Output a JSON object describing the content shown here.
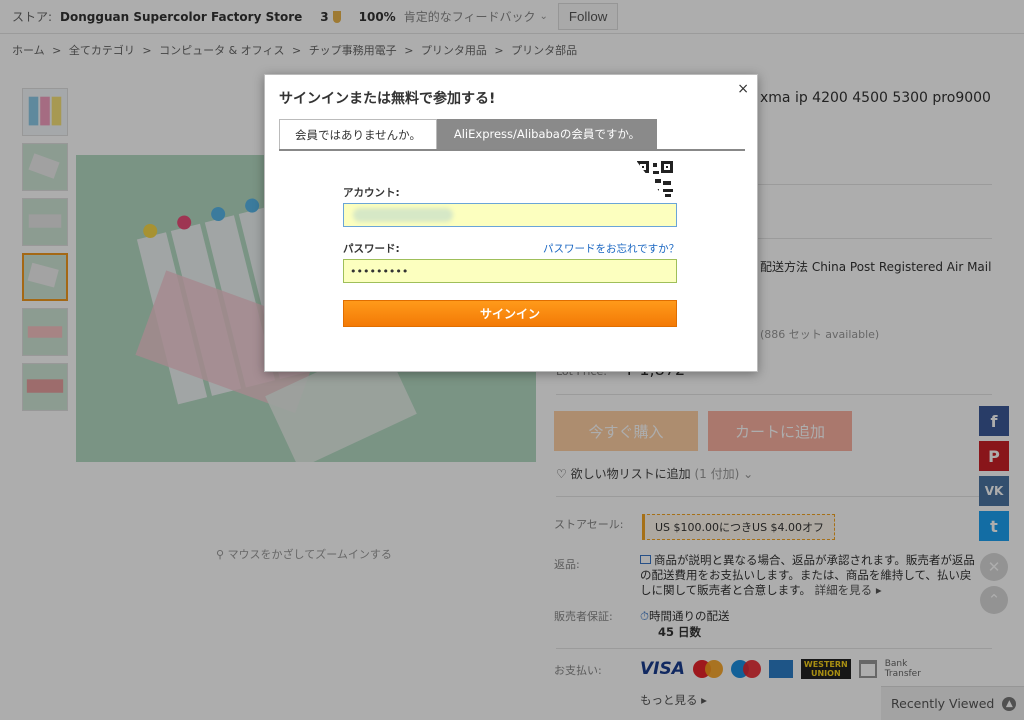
{
  "store_bar": {
    "label": "ストア:",
    "store_name": "Dongguan Supercolor Factory Store",
    "level": "3",
    "positive_pct": "100%",
    "feedback_label": "肯定的なフィードバック",
    "follow_label": "Follow"
  },
  "breadcrumb": [
    "ホーム",
    ">",
    "全てカテゴリ",
    ">",
    "コンピュータ & オフィス",
    ">",
    "チップ事務用電子",
    ">",
    "プリンタ用品",
    ">",
    "プリンタ部品"
  ],
  "product": {
    "title_tail": "xma ip 4200 4500 5300 pro9000",
    "shipping_tail": "配送方法 China Post Registered Air Mail",
    "stock_tail": "(886 セット available)",
    "price_label": "Lot Price:",
    "price": "¥ 1,872",
    "zoom_hint": "マウスをかざしてズームインする",
    "buy_now": "今すぐ購入",
    "add_to_cart": "カートに追加",
    "wishlist_label": "欲しい物リストに追加",
    "wishlist_count": "(1 付加)",
    "store_sale_label": "ストアセール:",
    "store_sale_value": "US $100.00につきUS $4.00オフ",
    "returns_label": "返品:",
    "returns_text": "商品が説明と異なる場合、返品が承認されます。販売者が返品の配送費用をお支払いします。または、商品を維持して、払い戻しに関して販売者と合意します。",
    "returns_more": "詳細を見る",
    "guarantee_label": "販売者保証:",
    "guarantee_text": "時間通りの配送",
    "guarantee_days": "45 日数",
    "payment_label": "お支払い:",
    "payment_visa": "VISA",
    "payment_wu_1": "WESTERN",
    "payment_wu_2": "UNION",
    "payment_bank_1": "Bank",
    "payment_bank_2": "Transfer",
    "payment_more": "もっと見る"
  },
  "social": {
    "facebook": "f",
    "pinterest": "P",
    "vk": "VK",
    "twitter": "t"
  },
  "recently_viewed": "Recently Viewed",
  "modal": {
    "title": "サインインまたは無料で参加する!",
    "close": "×",
    "tab_1": "会員ではありませんか。",
    "tab_2": "AliExpress/Alibabaの会員ですか。",
    "account_label": "アカウント:",
    "password_label": "パスワード:",
    "password_value": "•••••••••",
    "forgot_password": "パスワードをお忘れですか？",
    "signin_button": "サインイン"
  },
  "colors": {
    "accent_orange": "#f37a06",
    "link_blue": "#1b67c2",
    "input_yellow": "#fcffbf"
  }
}
